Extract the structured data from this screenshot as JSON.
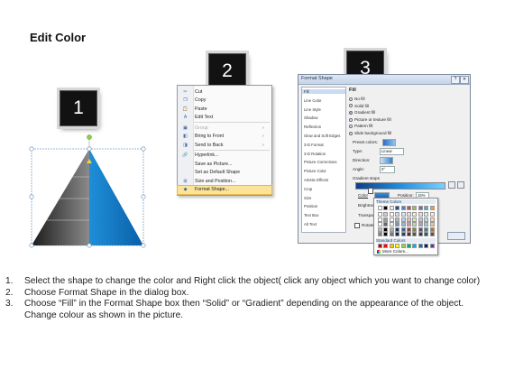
{
  "title": "Edit Color",
  "badges": [
    "1",
    "2",
    "3"
  ],
  "context_menu": {
    "items": [
      {
        "label": "Cut",
        "icon": "scissors-icon",
        "glyph": "✂",
        "disabled": false,
        "arrow": ""
      },
      {
        "label": "Copy",
        "icon": "copy-icon",
        "glyph": "❐",
        "disabled": false,
        "arrow": ""
      },
      {
        "label": "Paste",
        "icon": "paste-icon",
        "glyph": "📋",
        "disabled": false,
        "arrow": ""
      },
      {
        "label": "Edit Text",
        "icon": "edit-text-icon",
        "glyph": "A",
        "disabled": false,
        "arrow": ""
      },
      {
        "label": "Group",
        "icon": "group-icon",
        "glyph": "▣",
        "disabled": true,
        "arrow": "›"
      },
      {
        "label": "Bring to Front",
        "icon": "bring-front-icon",
        "glyph": "◧",
        "disabled": false,
        "arrow": "›"
      },
      {
        "label": "Send to Back",
        "icon": "send-back-icon",
        "glyph": "◨",
        "disabled": false,
        "arrow": "›"
      },
      {
        "label": "Hyperlink...",
        "icon": "hyperlink-icon",
        "glyph": "🔗",
        "disabled": false,
        "arrow": ""
      },
      {
        "label": "Save as Picture...",
        "icon": "",
        "glyph": "",
        "disabled": false,
        "arrow": ""
      },
      {
        "label": "Set as Default Shape",
        "icon": "",
        "glyph": "",
        "disabled": false,
        "arrow": ""
      },
      {
        "label": "Size and Position...",
        "icon": "size-position-icon",
        "glyph": "⊞",
        "disabled": false,
        "arrow": ""
      },
      {
        "label": "Format Shape...",
        "icon": "format-shape-icon",
        "glyph": "◆",
        "disabled": false,
        "arrow": "",
        "highlighted": true
      }
    ]
  },
  "dialog": {
    "title": "Format Shape",
    "nav": [
      "Fill",
      "Line Color",
      "Line Style",
      "Shadow",
      "Reflection",
      "Glow and Soft Edges",
      "3-D Format",
      "3-D Rotation",
      "Picture Corrections",
      "Picture Color",
      "Artistic Effects",
      "Crop",
      "Size",
      "Position",
      "Text Box",
      "Alt Text"
    ],
    "selected_nav": "Fill",
    "section": "Fill",
    "fill_options": [
      "No fill",
      "Solid fill",
      "Gradient fill",
      "Picture or texture fill",
      "Pattern fill",
      "Slide background fill"
    ],
    "selected_fill": "Gradient fill",
    "preset_label": "Preset colors:",
    "type_label": "Type:",
    "type_value": "Linear",
    "direction_label": "Direction:",
    "angle_label": "Angle:",
    "angle_value": "0°",
    "stops_label": "Gradient stops",
    "color_label": "Color",
    "position_label": "Position:",
    "position_value": "15%",
    "brightness_label": "Brightness",
    "transparency_label": "Transpare",
    "rotate_label": "Rotate"
  },
  "palette": {
    "theme_label": "Theme Colors",
    "standard_label": "Standard Colors",
    "more_label": "More Colors...",
    "theme_top": [
      "#ffffff",
      "#000000",
      "#eeece1",
      "#1f497d",
      "#4f81bd",
      "#c0504d",
      "#9bbb59",
      "#8064a2",
      "#4bacc6",
      "#f79646"
    ],
    "standard": [
      "#c00000",
      "#ff0000",
      "#ffc000",
      "#ffff00",
      "#92d050",
      "#00b050",
      "#00b0f0",
      "#0070c0",
      "#002060",
      "#7030a0"
    ]
  },
  "instructions": [
    {
      "num": "1.",
      "text": "Select the shape to change the color and Right click the object( click any object which you want to change color)"
    },
    {
      "num": "2.",
      "text": "Choose Format Shape in the dialog box."
    },
    {
      "num": "3.",
      "text": "Choose “Fill” in the Format Shape box then “Solid” or “Gradient” depending on the appearance of the object. Change colour as shown in the picture."
    }
  ]
}
